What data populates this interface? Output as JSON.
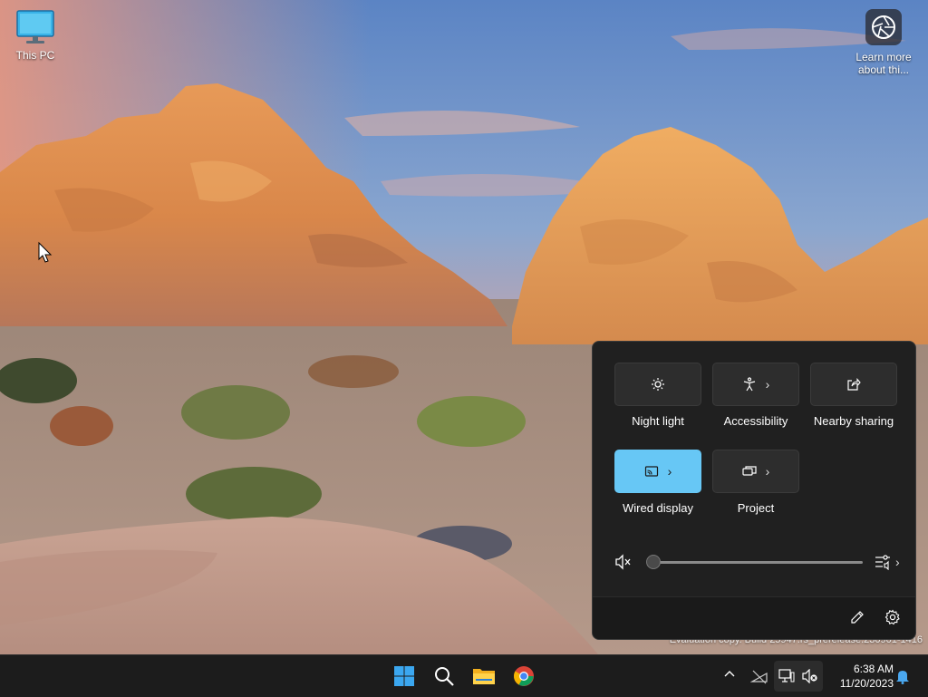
{
  "desktop": {
    "icons": [
      {
        "label": "This PC",
        "icon": "monitor-icon"
      },
      {
        "label": "Learn more about thi...",
        "icon": "camera-lens-icon"
      }
    ],
    "watermark": "Evaluation copy. Build 25947.rs_prerelease.230901-1416"
  },
  "quick_settings": {
    "tiles": [
      {
        "label": "Night light",
        "icon": "brightness-icon",
        "active": false,
        "has_chevron": false
      },
      {
        "label": "Accessibility",
        "icon": "accessibility-icon",
        "active": false,
        "has_chevron": true
      },
      {
        "label": "Nearby sharing",
        "icon": "share-icon",
        "active": false,
        "has_chevron": false
      },
      {
        "label": "Wired display",
        "icon": "cast-icon",
        "active": true,
        "has_chevron": true
      },
      {
        "label": "Project",
        "icon": "project-icon",
        "active": false,
        "has_chevron": true
      }
    ],
    "volume": {
      "level_percent": 0,
      "muted": true
    }
  },
  "taskbar": {
    "apps": [
      "start-icon",
      "search-icon",
      "file-explorer-icon",
      "chrome-icon"
    ],
    "clock": {
      "time": "6:38 AM",
      "date": "11/20/2023"
    }
  },
  "colors": {
    "accent": "#67c7f5",
    "taskbar": "#1c1c1c",
    "panel": "#202020"
  }
}
